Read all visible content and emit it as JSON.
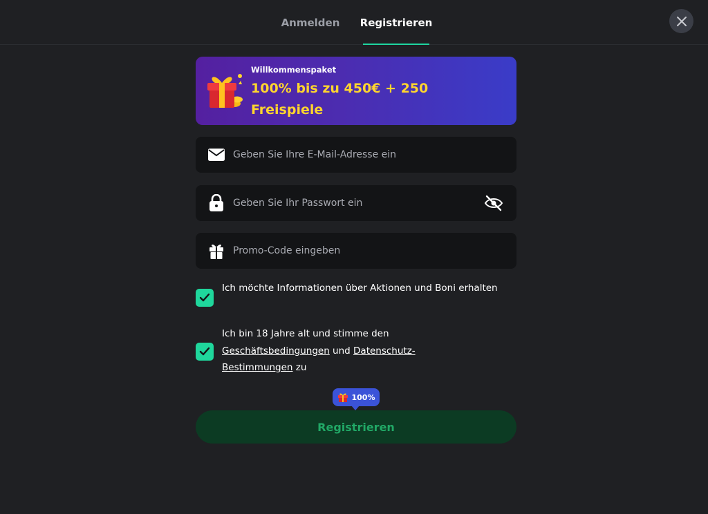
{
  "tabs": {
    "login": "Anmelden",
    "register": "Registrieren",
    "active": "register"
  },
  "close_icon": "close-icon",
  "banner": {
    "label": "Willkommenspaket",
    "title": "100% bis zu 450€ + 250 Freispiele",
    "icon": "gift-icon"
  },
  "form": {
    "email": {
      "placeholder": "Geben Sie Ihre E-Mail-Adresse ein",
      "value": "",
      "icon": "mail-icon"
    },
    "password": {
      "placeholder": "Geben Sie Ihr Passwort ein",
      "value": "",
      "icon": "lock-icon",
      "toggle_icon": "eye-off-icon"
    },
    "promo": {
      "placeholder": "Promo-Code eingeben",
      "value": "",
      "icon": "gift-icon"
    }
  },
  "checks": {
    "newsletter": {
      "checked": true,
      "text": "Ich möchte Informationen über Aktionen und Boni erhalten"
    },
    "terms": {
      "checked": true,
      "text_before": "Ich bin 18 Jahre alt und stimme den ",
      "link_terms": "Geschäftsbedingungen",
      "text_middle": " und ",
      "link_privacy": "Datenschutz-Bestimmungen",
      "text_after": " zu"
    }
  },
  "bonus_badge": {
    "label": "100%",
    "icon": "gift-icon"
  },
  "submit": {
    "label": "Registrieren"
  },
  "colors": {
    "background": "#1f2023",
    "accent": "#1ed6a0",
    "banner_text": "#ffd52e",
    "button_bg": "#0c3b23",
    "button_text": "#21a866"
  }
}
